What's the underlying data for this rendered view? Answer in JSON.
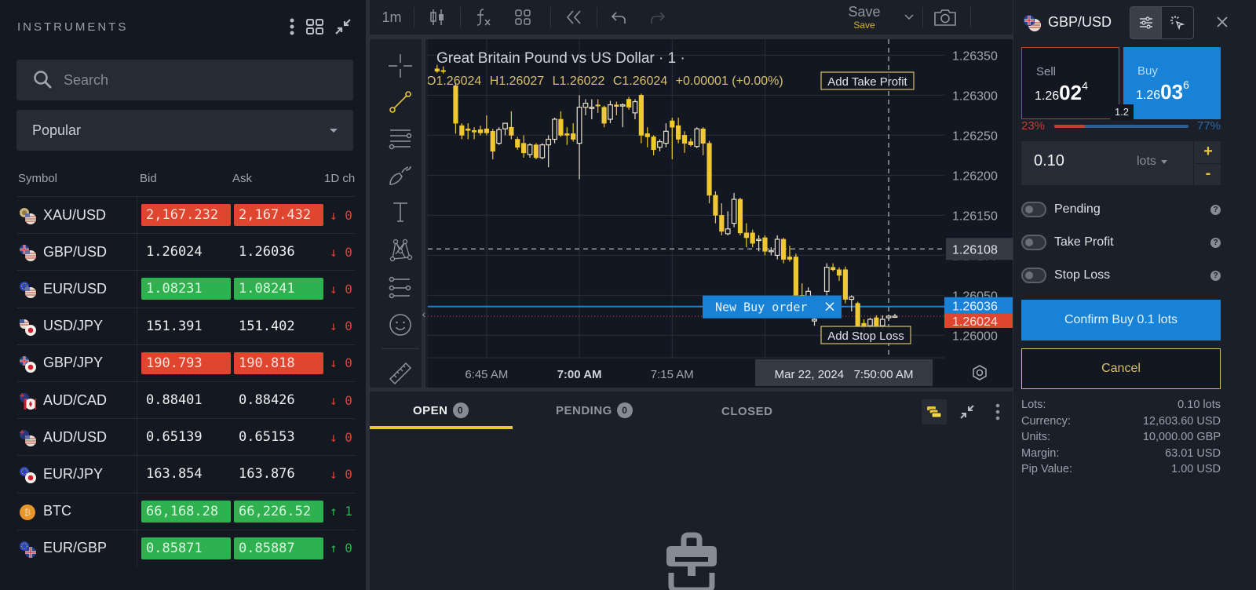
{
  "instruments": {
    "title": "INSTRUMENTS",
    "search_placeholder": "Search",
    "category": "Popular",
    "columns": [
      "Symbol",
      "Bid",
      "Ask",
      "1D ch"
    ],
    "rows": [
      {
        "symbol": "XAU/USD",
        "flag": "gold-usd",
        "bid": "2,167.232",
        "ask": "2,167.432",
        "state": "down",
        "change_arrow": "↓",
        "change": "0"
      },
      {
        "symbol": "GBP/USD",
        "flag": "gbp-usd",
        "bid": "1.26024",
        "ask": "1.26036",
        "state": "none",
        "change_arrow": "↓",
        "change": "0"
      },
      {
        "symbol": "EUR/USD",
        "flag": "eur-usd",
        "bid": "1.08231",
        "ask": "1.08241",
        "state": "up",
        "change_arrow": "↓",
        "change": "0"
      },
      {
        "symbol": "USD/JPY",
        "flag": "usd-jpy",
        "bid": "151.391",
        "ask": "151.402",
        "state": "none",
        "change_arrow": "↓",
        "change": "0"
      },
      {
        "symbol": "GBP/JPY",
        "flag": "gbp-jpy",
        "bid": "190.793",
        "ask": "190.818",
        "state": "down",
        "change_arrow": "↓",
        "change": "0"
      },
      {
        "symbol": "AUD/CAD",
        "flag": "aud-cad",
        "bid": "0.88401",
        "ask": "0.88426",
        "state": "none",
        "change_arrow": "↓",
        "change": "0"
      },
      {
        "symbol": "AUD/USD",
        "flag": "aud-usd",
        "bid": "0.65139",
        "ask": "0.65153",
        "state": "none",
        "change_arrow": "↓",
        "change": "0"
      },
      {
        "symbol": "EUR/JPY",
        "flag": "eur-jpy",
        "bid": "163.854",
        "ask": "163.876",
        "state": "none",
        "change_arrow": "↓",
        "change": "0"
      },
      {
        "symbol": "BTC",
        "flag": "btc",
        "bid": "66,168.28",
        "ask": "66,226.52",
        "state": "up",
        "change_arrow": "↑",
        "change": "1"
      },
      {
        "symbol": "EUR/GBP",
        "flag": "eur-gbp",
        "bid": "0.85871",
        "ask": "0.85887",
        "state": "up",
        "change_arrow": "↑",
        "change": "0"
      }
    ]
  },
  "toolbar": {
    "interval": "1m",
    "save_label": "Save",
    "save_sublabel": "Save"
  },
  "chart_data": {
    "type": "candlestick",
    "title": "Great Britain Pound vs US Dollar · 1 ·",
    "ohlc_legend": {
      "open": "1.26024",
      "high": "1.26027",
      "low": "1.26022",
      "close": "1.26024",
      "change": "+0.00001 (+0.00%)"
    },
    "x_ticks": [
      "6:45 AM",
      "7:00 AM",
      "7:15 AM",
      "7:"
    ],
    "x_tick_minutes": [
      405,
      420,
      435,
      450
    ],
    "x_range_minutes": [
      395.5,
      479
    ],
    "y_ticks": [
      "1.26350",
      "1.26300",
      "1.26250",
      "1.26200",
      "1.26150",
      "1.26100",
      "1.26050",
      "1.26000"
    ],
    "ylim": [
      1.25972,
      1.2637
    ],
    "crosshair_time": "Mar 22, 2024   7:50:00 AM",
    "crosshair_minute": 470,
    "crosshair_price_label": "1.26108",
    "crosshair_price": 1.26108,
    "ask_line": {
      "label": "1.26036",
      "price": 1.26036,
      "color": "#1882d6"
    },
    "bid_line": {
      "label": "1.26024",
      "price": 1.26024,
      "color": "#e0462f"
    },
    "annotations": {
      "take_profit": "Add Take Profit",
      "stop_loss": "Add Stop Loss",
      "new_order": "New Buy order"
    },
    "candles": [
      {
        "t": 397,
        "o": 1.26333,
        "h": 1.26338,
        "l": 1.26328,
        "c": 1.2633
      },
      {
        "t": 398,
        "o": 1.26331,
        "h": 1.26336,
        "l": 1.26327,
        "c": 1.2633
      },
      {
        "t": 400,
        "o": 1.26312,
        "h": 1.26316,
        "l": 1.26252,
        "c": 1.26265
      },
      {
        "t": 401,
        "o": 1.26262,
        "h": 1.26265,
        "l": 1.26245,
        "c": 1.2625
      },
      {
        "t": 402,
        "o": 1.26258,
        "h": 1.26265,
        "l": 1.26245,
        "c": 1.26256
      },
      {
        "t": 403,
        "o": 1.26256,
        "h": 1.2626,
        "l": 1.26245,
        "c": 1.26254
      },
      {
        "t": 404,
        "o": 1.26257,
        "h": 1.26262,
        "l": 1.2625,
        "c": 1.26253
      },
      {
        "t": 405,
        "o": 1.26258,
        "h": 1.26275,
        "l": 1.2625,
        "c": 1.26253
      },
      {
        "t": 406,
        "o": 1.26255,
        "h": 1.26258,
        "l": 1.2622,
        "c": 1.2623
      },
      {
        "t": 407,
        "o": 1.2624,
        "h": 1.2626,
        "l": 1.26238,
        "c": 1.26257
      },
      {
        "t": 408,
        "o": 1.26258,
        "h": 1.26265,
        "l": 1.2625,
        "c": 1.26265
      },
      {
        "t": 409,
        "o": 1.2626,
        "h": 1.2628,
        "l": 1.26245,
        "c": 1.2625
      },
      {
        "t": 410,
        "o": 1.26245,
        "h": 1.26248,
        "l": 1.26232,
        "c": 1.26235
      },
      {
        "t": 411,
        "o": 1.2624,
        "h": 1.2625,
        "l": 1.26222,
        "c": 1.26228
      },
      {
        "t": 412,
        "o": 1.26226,
        "h": 1.2624,
        "l": 1.26222,
        "c": 1.26238
      },
      {
        "t": 413,
        "o": 1.26238,
        "h": 1.2624,
        "l": 1.2622,
        "c": 1.26222
      },
      {
        "t": 414,
        "o": 1.26222,
        "h": 1.2624,
        "l": 1.2622,
        "c": 1.26238
      },
      {
        "t": 415,
        "o": 1.26238,
        "h": 1.2625,
        "l": 1.2621,
        "c": 1.26245
      },
      {
        "t": 416,
        "o": 1.26245,
        "h": 1.26272,
        "l": 1.2624,
        "c": 1.2627
      },
      {
        "t": 417,
        "o": 1.2627,
        "h": 1.2628,
        "l": 1.26248,
        "c": 1.2625
      },
      {
        "t": 418,
        "o": 1.26252,
        "h": 1.2626,
        "l": 1.26238,
        "c": 1.2625
      },
      {
        "t": 419,
        "o": 1.26252,
        "h": 1.26265,
        "l": 1.26242,
        "c": 1.26245
      },
      {
        "t": 420,
        "o": 1.2624,
        "h": 1.263,
        "l": 1.26195,
        "c": 1.26285
      },
      {
        "t": 421,
        "o": 1.26285,
        "h": 1.26295,
        "l": 1.26275,
        "c": 1.2629
      },
      {
        "t": 422,
        "o": 1.26285,
        "h": 1.26295,
        "l": 1.2627,
        "c": 1.26285
      },
      {
        "t": 423,
        "o": 1.26288,
        "h": 1.26295,
        "l": 1.26278,
        "c": 1.26287
      },
      {
        "t": 424,
        "o": 1.26285,
        "h": 1.26287,
        "l": 1.2626,
        "c": 1.26265
      },
      {
        "t": 425,
        "o": 1.2627,
        "h": 1.26293,
        "l": 1.26265,
        "c": 1.26288
      },
      {
        "t": 426,
        "o": 1.26288,
        "h": 1.26292,
        "l": 1.26275,
        "c": 1.26286
      },
      {
        "t": 427,
        "o": 1.26288,
        "h": 1.2629,
        "l": 1.2626,
        "c": 1.26288
      },
      {
        "t": 428,
        "o": 1.26295,
        "h": 1.26298,
        "l": 1.26282,
        "c": 1.26285
      },
      {
        "t": 429,
        "o": 1.26278,
        "h": 1.26295,
        "l": 1.2627,
        "c": 1.26292
      },
      {
        "t": 430,
        "o": 1.263,
        "h": 1.26302,
        "l": 1.2624,
        "c": 1.2625
      },
      {
        "t": 431,
        "o": 1.26252,
        "h": 1.2626,
        "l": 1.26235,
        "c": 1.26248
      },
      {
        "t": 432,
        "o": 1.26248,
        "h": 1.2625,
        "l": 1.26225,
        "c": 1.26232
      },
      {
        "t": 433,
        "o": 1.26235,
        "h": 1.26245,
        "l": 1.2623,
        "c": 1.26242
      },
      {
        "t": 434,
        "o": 1.2624,
        "h": 1.26265,
        "l": 1.26235,
        "c": 1.26255
      },
      {
        "t": 435,
        "o": 1.26268,
        "h": 1.26272,
        "l": 1.2622,
        "c": 1.2626
      },
      {
        "t": 436,
        "o": 1.26262,
        "h": 1.26272,
        "l": 1.2624,
        "c": 1.26245
      },
      {
        "t": 437,
        "o": 1.2625,
        "h": 1.26255,
        "l": 1.26228,
        "c": 1.2624
      },
      {
        "t": 438,
        "o": 1.26242,
        "h": 1.26246,
        "l": 1.26236,
        "c": 1.26238
      },
      {
        "t": 439,
        "o": 1.26236,
        "h": 1.2626,
        "l": 1.26234,
        "c": 1.26258
      },
      {
        "t": 440,
        "o": 1.26258,
        "h": 1.2626,
        "l": 1.26225,
        "c": 1.2624
      },
      {
        "t": 441,
        "o": 1.2624,
        "h": 1.26243,
        "l": 1.26165,
        "c": 1.26175
      },
      {
        "t": 442,
        "o": 1.26175,
        "h": 1.2618,
        "l": 1.2614,
        "c": 1.2615
      },
      {
        "t": 443,
        "o": 1.2615,
        "h": 1.26165,
        "l": 1.26125,
        "c": 1.2613
      },
      {
        "t": 444,
        "o": 1.26127,
        "h": 1.26155,
        "l": 1.26125,
        "c": 1.26133
      },
      {
        "t": 445,
        "o": 1.2614,
        "h": 1.26178,
        "l": 1.26135,
        "c": 1.2617
      },
      {
        "t": 446,
        "o": 1.2617,
        "h": 1.26172,
        "l": 1.26125,
        "c": 1.26128
      },
      {
        "t": 447,
        "o": 1.26128,
        "h": 1.2614,
        "l": 1.2611,
        "c": 1.26122
      },
      {
        "t": 448,
        "o": 1.26128,
        "h": 1.26132,
        "l": 1.2611,
        "c": 1.26115
      },
      {
        "t": 449,
        "o": 1.2612,
        "h": 1.26125,
        "l": 1.26105,
        "c": 1.2612
      },
      {
        "t": 450,
        "o": 1.26122,
        "h": 1.26125,
        "l": 1.261,
        "c": 1.26105
      },
      {
        "t": 451,
        "o": 1.26105,
        "h": 1.2611,
        "l": 1.261,
        "c": 1.26106
      },
      {
        "t": 452,
        "o": 1.261,
        "h": 1.26125,
        "l": 1.26095,
        "c": 1.2612
      },
      {
        "t": 453,
        "o": 1.2612,
        "h": 1.26122,
        "l": 1.2609,
        "c": 1.26095
      },
      {
        "t": 454,
        "o": 1.26098,
        "h": 1.26112,
        "l": 1.26092,
        "c": 1.26095
      },
      {
        "t": 455,
        "o": 1.26098,
        "h": 1.26102,
        "l": 1.26045,
        "c": 1.2605
      },
      {
        "t": 456,
        "o": 1.2605,
        "h": 1.26065,
        "l": 1.26035,
        "c": 1.26045
      },
      {
        "t": 457,
        "o": 1.26045,
        "h": 1.2606,
        "l": 1.2604,
        "c": 1.26055
      },
      {
        "t": 458,
        "o": 1.26018,
        "h": 1.26022,
        "l": 1.26012,
        "c": 1.2602
      },
      {
        "t": 459,
        "o": 1.26025,
        "h": 1.26048,
        "l": 1.26022,
        "c": 1.26045
      },
      {
        "t": 460,
        "o": 1.26055,
        "h": 1.2609,
        "l": 1.2605,
        "c": 1.26085
      },
      {
        "t": 461,
        "o": 1.26085,
        "h": 1.2609,
        "l": 1.2608,
        "c": 1.26082
      },
      {
        "t": 462,
        "o": 1.26082,
        "h": 1.26085,
        "l": 1.26068,
        "c": 1.26075
      },
      {
        "t": 463,
        "o": 1.26082,
        "h": 1.26086,
        "l": 1.2604,
        "c": 1.26045
      },
      {
        "t": 464,
        "o": 1.26045,
        "h": 1.2605,
        "l": 1.2603,
        "c": 1.26048
      },
      {
        "t": 465,
        "o": 1.2604,
        "h": 1.26042,
        "l": 1.2601,
        "c": 1.26012
      },
      {
        "t": 466,
        "o": 1.26015,
        "h": 1.2602,
        "l": 1.26005,
        "c": 1.2601
      },
      {
        "t": 467,
        "o": 1.26012,
        "h": 1.26022,
        "l": 1.26008,
        "c": 1.2602
      },
      {
        "t": 468,
        "o": 1.26022,
        "h": 1.26025,
        "l": 1.26008,
        "c": 1.26012
      },
      {
        "t": 469,
        "o": 1.26012,
        "h": 1.26025,
        "l": 1.26008,
        "c": 1.2602
      },
      {
        "t": 470,
        "o": 1.26022,
        "h": 1.26026,
        "l": 1.26018,
        "c": 1.26024
      },
      {
        "t": 471,
        "o": 1.26024,
        "h": 1.26027,
        "l": 1.26022,
        "c": 1.26024
      }
    ]
  },
  "orders": {
    "tabs": [
      {
        "label": "OPEN",
        "count": "0"
      },
      {
        "label": "PENDING",
        "count": "0"
      },
      {
        "label": "CLOSED"
      }
    ]
  },
  "order_ticket": {
    "symbol": "GBP/USD",
    "sell": {
      "label": "Sell",
      "price_prefix": "1.26",
      "price_big": "02",
      "price_pip": "4"
    },
    "buy": {
      "label": "Buy",
      "price_prefix": "1.26",
      "price_big": "03",
      "price_pip": "6"
    },
    "spread": "1.2",
    "sentiment": {
      "sell_pct": "23%",
      "buy_pct": "77%",
      "sell_fraction": 0.23
    },
    "quantity": "0.10",
    "unit": "lots",
    "plus": "+",
    "minus": "-",
    "toggles": [
      {
        "label": "Pending",
        "on": false
      },
      {
        "label": "Take Profit",
        "on": false
      },
      {
        "label": "Stop Loss",
        "on": false
      }
    ],
    "confirm_label": "Confirm Buy 0.1 lots",
    "cancel_label": "Cancel",
    "summary": [
      {
        "label": "Lots:",
        "value": "0.10 lots"
      },
      {
        "label": "Currency:",
        "value": "12,603.60 USD"
      },
      {
        "label": "Units:",
        "value": "10,000.00 GBP"
      },
      {
        "label": "Margin:",
        "value": "63.01 USD"
      },
      {
        "label": "Pip Value:",
        "value": "1.00 USD"
      }
    ]
  },
  "colors": {
    "candle": "#f0c930",
    "up": "#2fb150",
    "down": "#e0462f",
    "accent_blue": "#1882d6",
    "accent_yellow": "#e8c53f"
  }
}
